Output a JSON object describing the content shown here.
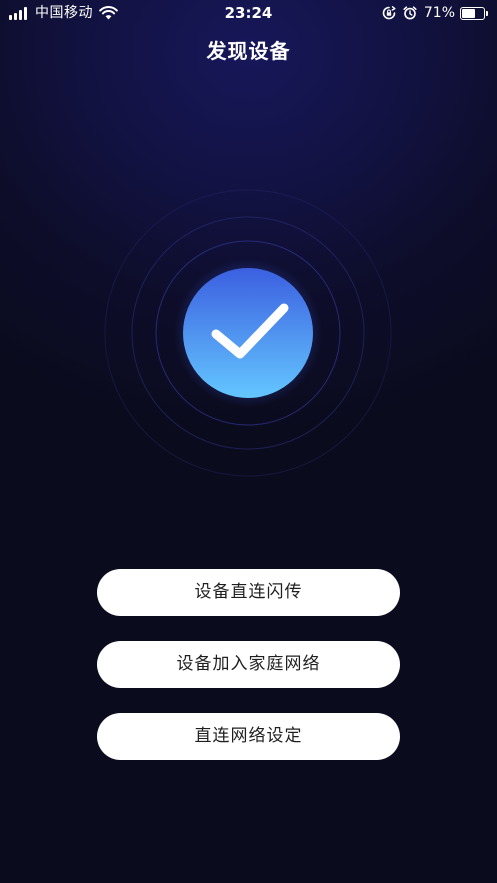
{
  "status_bar": {
    "carrier": "中国移动",
    "time": "23:24",
    "battery_percent": "71%",
    "battery_level": 0.71,
    "icons": [
      "signal-icon",
      "wifi-icon",
      "orientation-lock-icon",
      "alarm-icon",
      "battery-icon"
    ]
  },
  "header": {
    "title": "发现设备"
  },
  "success_graphic": {
    "icon": "checkmark-icon",
    "gradient_top": "#3b5fe0",
    "gradient_bottom": "#64c6ff"
  },
  "actions": {
    "direct_flash_label": "设备直连闪传",
    "join_home_network_label": "设备加入家庭网络",
    "direct_network_settings_label": "直连网络设定"
  },
  "colors": {
    "background": "#0b0b1e",
    "button_bg": "#ffffff",
    "button_text": "#1f1f1f"
  }
}
